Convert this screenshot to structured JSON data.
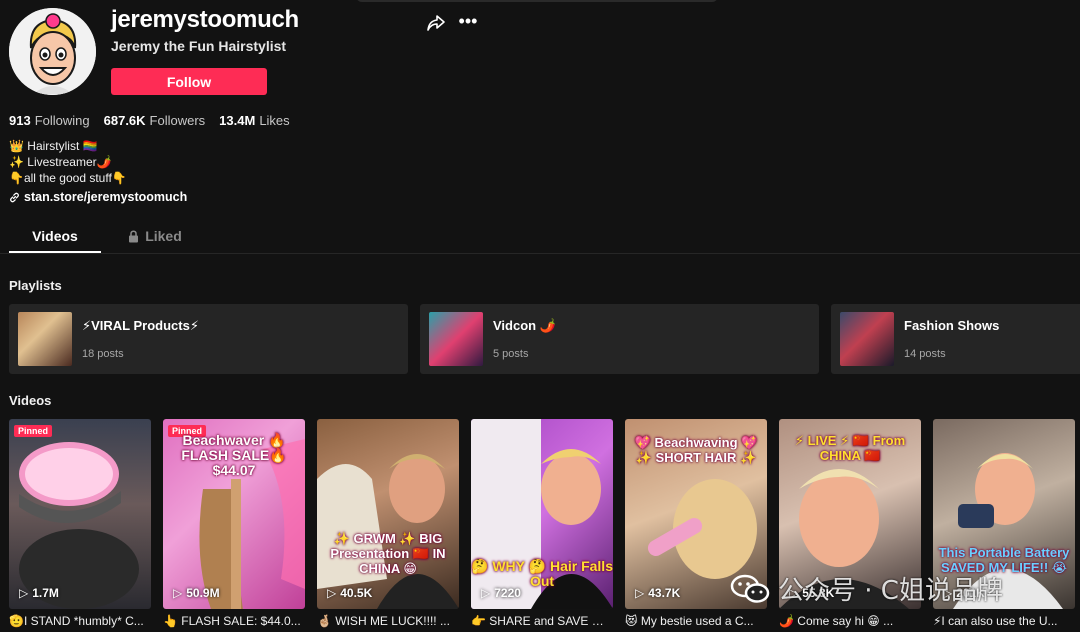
{
  "profile": {
    "username": "jeremystoomuch",
    "nickname": "Jeremy the Fun Hairstylist",
    "follow_label": "Follow"
  },
  "stats": [
    {
      "value": "913",
      "label": "Following"
    },
    {
      "value": "687.6K",
      "label": "Followers"
    },
    {
      "value": "13.4M",
      "label": "Likes"
    }
  ],
  "bio": [
    "👑 Hairstylist 🏳️‍🌈",
    "✨ Livestreamer🌶️",
    "👇all the good stuff👇"
  ],
  "link": "stan.store/jeremystoomuch",
  "tabs": {
    "videos": "Videos",
    "liked": "Liked"
  },
  "sections": {
    "playlists": "Playlists",
    "videos": "Videos"
  },
  "playlists": [
    {
      "name": "⚡VIRAL Products⚡",
      "count": "18 posts"
    },
    {
      "name": "Vidcon 🌶️",
      "count": "5 posts"
    },
    {
      "name": "Fashion Shows",
      "count": "14 posts"
    }
  ],
  "videos": [
    {
      "pinned": "Pinned",
      "views": "1.7M",
      "overlay": "",
      "caption": "🫡I STAND *humbly* C..."
    },
    {
      "pinned": "Pinned",
      "views": "50.9M",
      "overlay": "Beachwaver 🔥 FLASH SALE🔥 $44.07",
      "caption": "👆 FLASH SALE: $44.0..."
    },
    {
      "pinned": "",
      "views": "40.5K",
      "overlay": "✨ GRWM ✨ BIG Presentation 🇨🇳 IN CHINA 😁",
      "caption": "🤞🏼 WISH ME LUCK!!!! ..."
    },
    {
      "pinned": "",
      "views": "7220",
      "overlay": "🤔 WHY 🤔 Hair Falls Out",
      "caption": "👉 SHARE and SAVE 🀄..."
    },
    {
      "pinned": "",
      "views": "43.7K",
      "overlay": "💖 Beachwaving 💖 ✨ SHORT HAIR ✨",
      "caption": "😻 My bestie used a C..."
    },
    {
      "pinned": "",
      "views": "55.3K",
      "overlay": "⚡ LIVE ⚡ 🇨🇳 From CHINA 🇨🇳",
      "caption": "🌶️ Come say hi 😁 ..."
    },
    {
      "pinned": "",
      "views": "201K",
      "overlay": "This Portable Battery SAVED MY LIFE!! 😭",
      "caption": "⚡I can also use the U..."
    }
  ],
  "watermark": "公众号 · C姐说品牌",
  "colors": {
    "background": "#121212",
    "accent": "#fe2c55",
    "card": "#252525"
  }
}
